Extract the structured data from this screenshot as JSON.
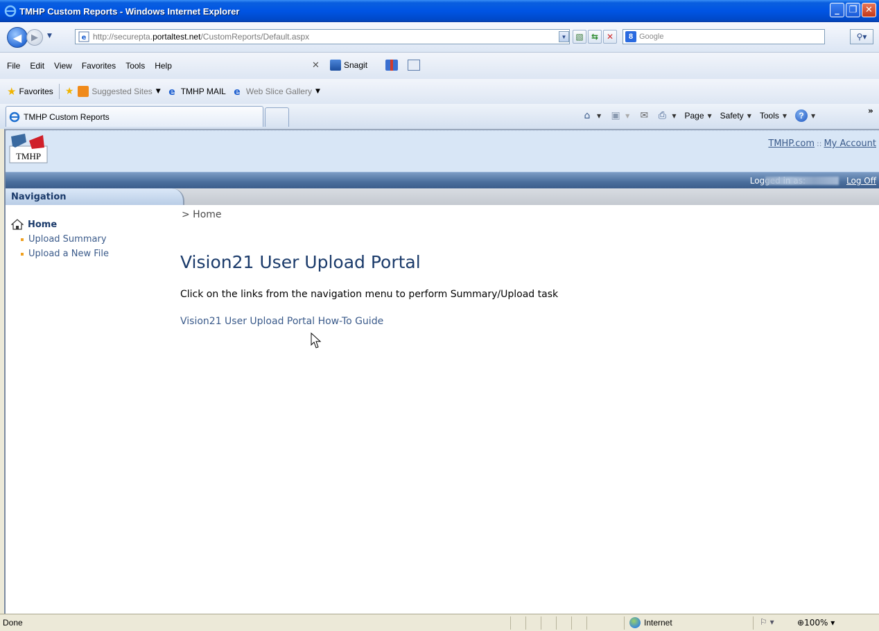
{
  "window": {
    "title": "TMHP Custom Reports - Windows Internet Explorer",
    "buttons": {
      "minimize": "_",
      "restore": "❐",
      "close": "✕"
    }
  },
  "address_bar": {
    "url_prefix": "http://securepta.",
    "url_domain": "portaltest.net",
    "url_path": "/CustomReports/Default.aspx",
    "search_provider_icon": "8",
    "search_placeholder": "Google"
  },
  "menu": [
    "File",
    "Edit",
    "View",
    "Favorites",
    "Tools",
    "Help"
  ],
  "snagit_label": "Snagit",
  "favorites": {
    "label": "Favorites",
    "items": [
      {
        "label": "Suggested Sites",
        "has_dropdown": true
      },
      {
        "label": "TMHP MAIL",
        "has_dropdown": false
      },
      {
        "label": "Web Slice Gallery",
        "has_dropdown": true
      }
    ]
  },
  "tab": {
    "title": "TMHP Custom Reports"
  },
  "command_bar": {
    "page": "Page",
    "safety": "Safety",
    "tools": "Tools",
    "help": "?"
  },
  "site": {
    "logo_text": "TMHP",
    "links": {
      "tmhp": "TMHP.com",
      "separator": "::",
      "account": "My Account"
    },
    "logged_in_label": "Logged in as:",
    "logoff": "Log Off",
    "nav_heading": "Navigation",
    "nav": {
      "home": "Home",
      "items": [
        "Upload Summary",
        "Upload a New File"
      ]
    },
    "breadcrumb": "> Home",
    "title": "Vision21 User Upload Portal",
    "intro": "Click on the links from the navigation menu to perform Summary/Upload task",
    "guide_link": "Vision21 User Upload Portal How-To Guide"
  },
  "status_bar": {
    "status": "Done",
    "zone": "Internet",
    "zoom": "100%"
  },
  "colors": {
    "title_blue": "#0054e3",
    "header_bg": "#d8e6f6",
    "user_bar": "#4a6e9c",
    "link": "#3a5a8a",
    "heading": "#1a3a6a",
    "bullet": "#f0a020"
  }
}
